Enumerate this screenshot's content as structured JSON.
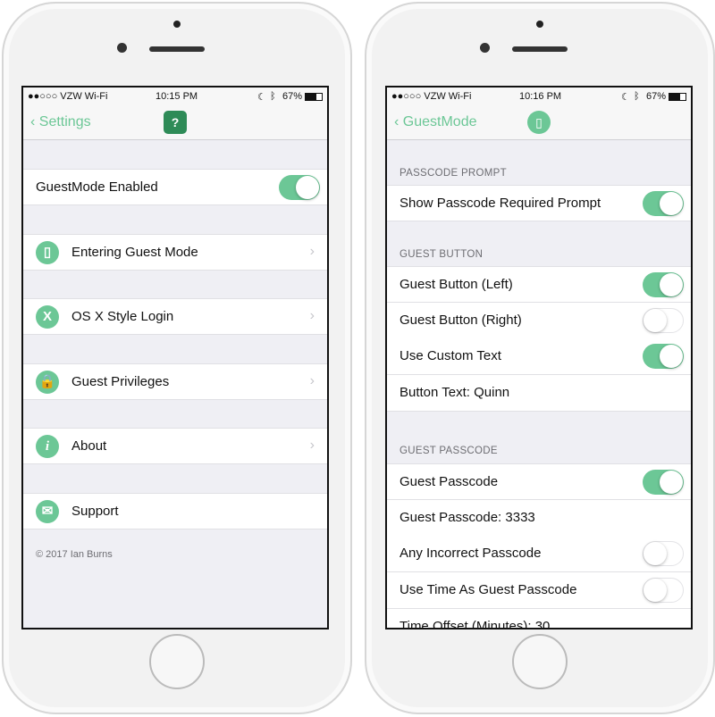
{
  "colors": {
    "accent": "#6cc796"
  },
  "left": {
    "status": {
      "carrier": "●●○○○ VZW Wi-Fi",
      "wifi": "wifi-icon",
      "time": "10:15 PM",
      "battery": "67%"
    },
    "nav": {
      "back": "Settings",
      "icon": "guestmode-app-icon"
    },
    "rows": [
      {
        "label": "GuestMode Enabled",
        "toggle": true
      },
      {
        "label": "Entering Guest Mode",
        "icon": "door-icon",
        "glyph": "▯",
        "chevron": true
      },
      {
        "label": "OS X Style Login",
        "icon": "x-icon",
        "glyph": "X",
        "chevron": true
      },
      {
        "label": "Guest Privileges",
        "icon": "lock-icon",
        "glyph": "🔒",
        "chevron": true
      },
      {
        "label": "About",
        "icon": "info-icon",
        "glyph": "i",
        "chevron": true
      },
      {
        "label": "Support",
        "icon": "envelope-icon",
        "glyph": "✉"
      }
    ],
    "footer": "© 2017 Ian Burns"
  },
  "right": {
    "status": {
      "carrier": "●●○○○ VZW Wi-Fi",
      "wifi": "wifi-icon",
      "time": "10:16 PM",
      "battery": "67%"
    },
    "nav": {
      "back": "GuestMode",
      "icon": "door-icon"
    },
    "sections": [
      {
        "header": "PASSCODE PROMPT",
        "rows": [
          {
            "label": "Show Passcode Required Prompt",
            "toggle": true
          }
        ]
      },
      {
        "header": "GUEST BUTTON",
        "rows": [
          {
            "label": "Guest Button (Left)",
            "toggle": true
          },
          {
            "label": "Guest Button (Right)",
            "toggle": false
          },
          {
            "label": "Use Custom Text",
            "toggle": true
          },
          {
            "label": "Button Text:  Quinn"
          }
        ]
      },
      {
        "header": "GUEST PASSCODE",
        "rows": [
          {
            "label": "Guest Passcode",
            "toggle": true
          },
          {
            "label": "Guest Passcode:  3333"
          },
          {
            "label": "Any Incorrect Passcode",
            "toggle": false
          },
          {
            "label": "Use Time As Guest Passcode",
            "toggle": false
          },
          {
            "label": "Time Offset (Minutes):  30"
          }
        ]
      }
    ]
  }
}
